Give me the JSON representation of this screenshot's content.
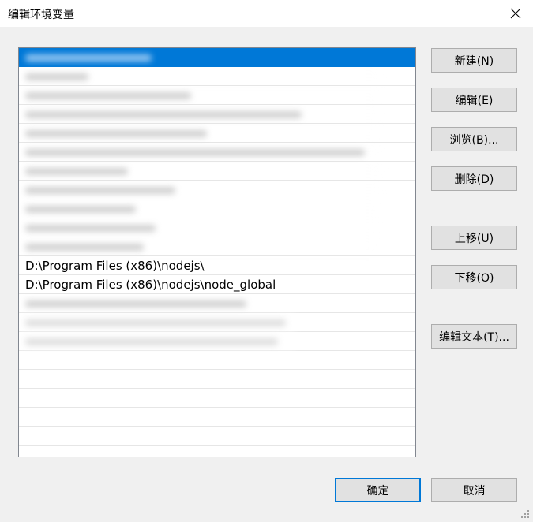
{
  "window": {
    "title": "编辑环境变量"
  },
  "paths": [
    {
      "text": "",
      "blurred": true,
      "selected": true,
      "blur_width": 160
    },
    {
      "text": "",
      "blurred": true,
      "selected": false,
      "blur_width": 80
    },
    {
      "text": "",
      "blurred": true,
      "selected": false,
      "blur_width": 210
    },
    {
      "text": "",
      "blurred": true,
      "selected": false,
      "blur_width": 350
    },
    {
      "text": "",
      "blurred": true,
      "selected": false,
      "blur_width": 230
    },
    {
      "text": "",
      "blurred": true,
      "selected": false,
      "blur_width": 430
    },
    {
      "text": "",
      "blurred": true,
      "selected": false,
      "blur_width": 130
    },
    {
      "text": "",
      "blurred": true,
      "selected": false,
      "blur_width": 190
    },
    {
      "text": "",
      "blurred": true,
      "selected": false,
      "blur_width": 140
    },
    {
      "text": "",
      "blurred": true,
      "selected": false,
      "blur_width": 165
    },
    {
      "text": "",
      "blurred": true,
      "selected": false,
      "blur_width": 150
    },
    {
      "text": "D:\\Program Files (x86)\\nodejs\\",
      "blurred": false,
      "selected": false
    },
    {
      "text": "D:\\Program Files (x86)\\nodejs\\node_global",
      "blurred": false,
      "selected": false
    },
    {
      "text": "",
      "blurred": true,
      "selected": false,
      "blur_width": 280
    },
    {
      "text": "",
      "blurred": true,
      "selected": false,
      "blur_width": 330
    },
    {
      "text": "",
      "blurred": true,
      "selected": false,
      "blur_width": 320
    }
  ],
  "empty_rows": 6,
  "buttons": {
    "new": "新建(N)",
    "edit": "编辑(E)",
    "browse": "浏览(B)...",
    "delete": "删除(D)",
    "move_up": "上移(U)",
    "move_down": "下移(O)",
    "edit_text": "编辑文本(T)...",
    "ok": "确定",
    "cancel": "取消"
  },
  "colors": {
    "selection": "#0078d7",
    "window_bg": "#f0f0f0",
    "button_bg": "#e1e1e1",
    "button_border": "#adadad"
  }
}
